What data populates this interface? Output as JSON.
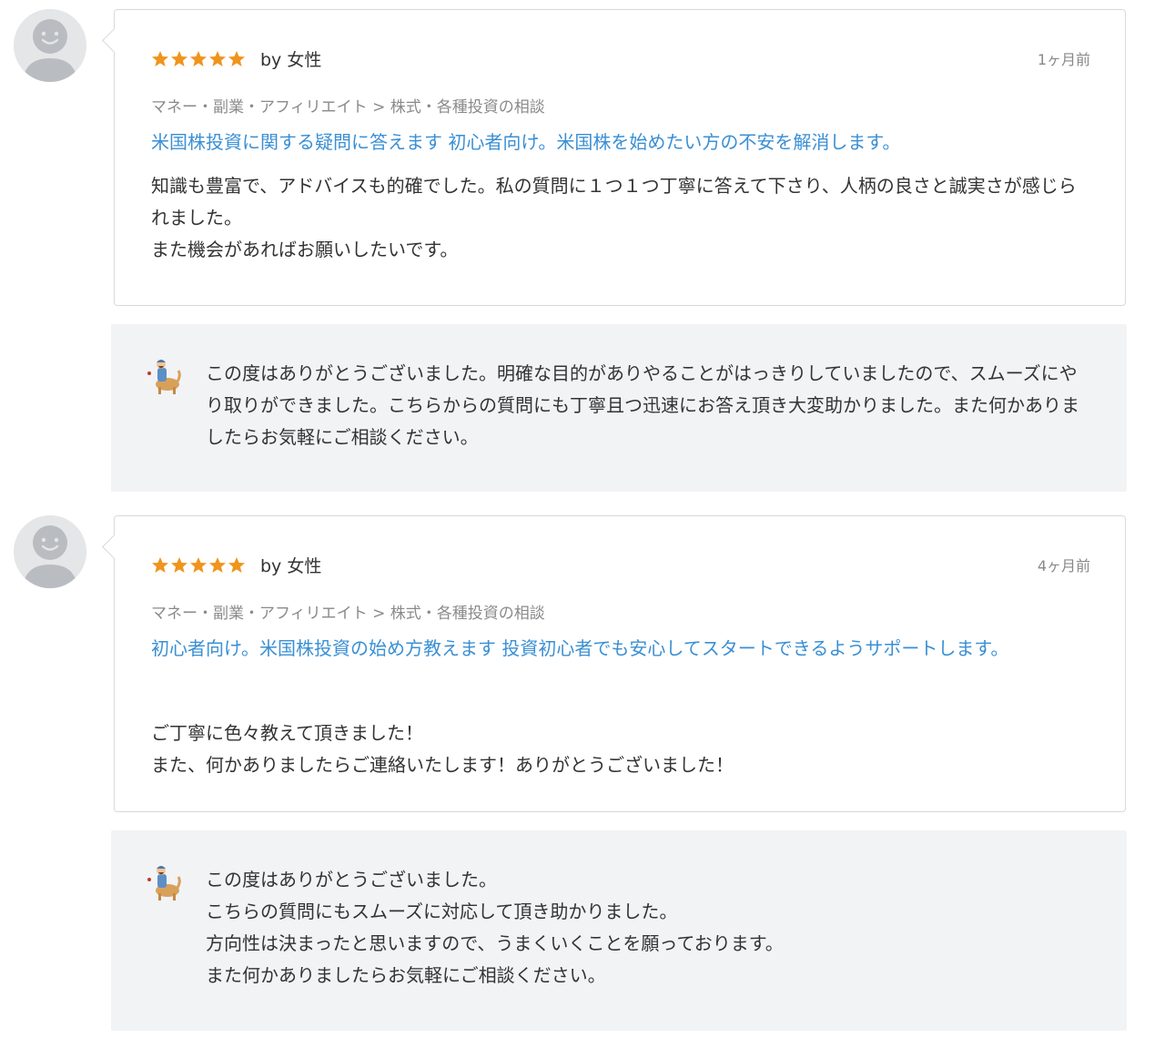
{
  "colors": {
    "star": "#f0941c",
    "link": "#3a8fd4",
    "reply_bg": "#f2f3f5",
    "border": "#d6d9dd"
  },
  "reviews": [
    {
      "rating": 5,
      "by_label": "by 女性",
      "date": "1ヶ月前",
      "category": "マネー・副業・アフィリエイト > 株式・各種投資の相談",
      "service_title": "米国株投資に関する疑問に答えます 初心者向け。米国株を始めたい方の不安を解消します。",
      "text": "知識も豊富で、アドバイスも的確でした。私の質問に１つ１つ丁寧に答えて下さり、人柄の良さと誠実さが感じられました。\nまた機会があればお願いしたいです。",
      "reply": "この度はありがとうございました。明確な目的がありやることがはっきりしていましたので、スムーズにやり取りができました。こちらからの質問にも丁寧且つ迅速にお答え頂き大変助かりました。また何かありましたらお気軽にご相談ください。"
    },
    {
      "rating": 5,
      "by_label": "by 女性",
      "date": "4ヶ月前",
      "category": "マネー・副業・アフィリエイト > 株式・各種投資の相談",
      "service_title": "初心者向け。米国株投資の始め方教えます 投資初心者でも安心してスタートできるようサポートします。",
      "text": "ご丁寧に色々教えて頂きました！\nまた、何かありましたらご連絡いたします！ありがとうございました！",
      "reply": "この度はありがとうございました。\nこちらの質問にもスムーズに対応して頂き助かりました。\n方向性は決まったと思いますので、うまくいくことを願っております。\nまた何かありましたらお気軽にご相談ください。"
    }
  ]
}
